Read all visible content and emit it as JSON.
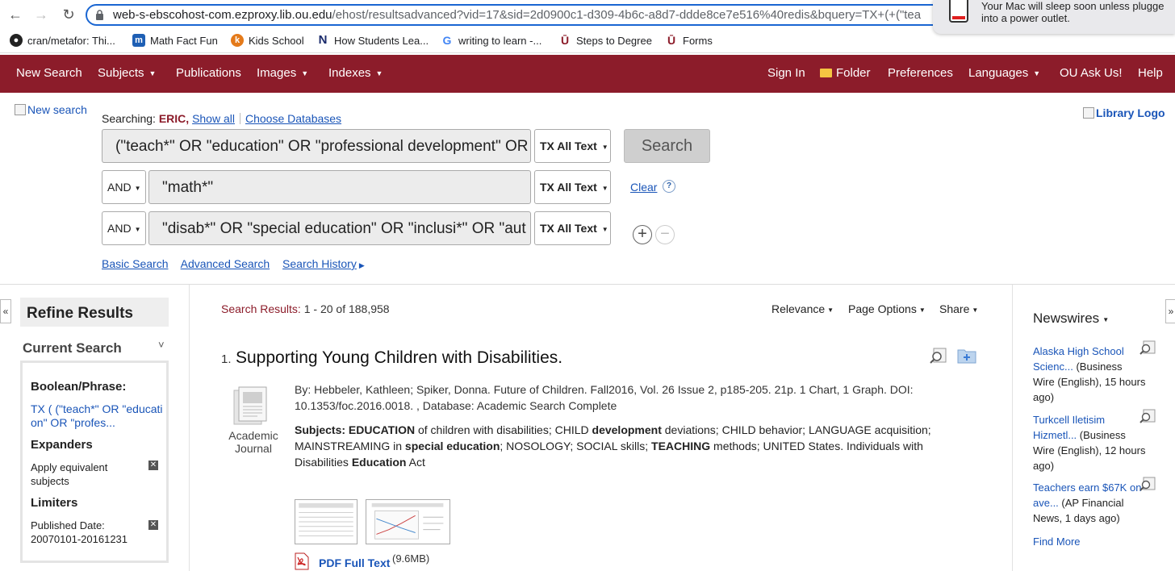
{
  "browser": {
    "url_host": "web-s-ebscohost-com.ezproxy.lib.ou.edu",
    "url_path": "/ehost/resultsadvanced?vid=17&sid=2d0900c1-d309-4b6c-a8d7-ddde8ce7e516%40redis&bquery=TX+(+(\"tea",
    "bookmarks": [
      "cran/metafor: Thi...",
      "Math Fact Fun",
      "Kids School",
      "How Students Lea...",
      "writing to learn -...",
      "Steps to Degree",
      "Forms"
    ],
    "notification": {
      "line1": "Your Mac will sleep soon unless plugge",
      "line2": "into a power outlet."
    }
  },
  "toolbar": {
    "new_search": "New Search",
    "subjects": "Subjects",
    "publications": "Publications",
    "images": "Images",
    "indexes": "Indexes",
    "sign_in": "Sign In",
    "folder": "Folder",
    "preferences": "Preferences",
    "languages": "Languages",
    "ask_us": "OU Ask Us!",
    "help": "Help"
  },
  "search": {
    "new_search_img_alt": "New search",
    "library_logo_alt": "Library Logo",
    "searching_label": "Searching:",
    "database": "ERIC,",
    "show_all": "Show all",
    "choose_databases": "Choose Databases",
    "rows": [
      {
        "bool": "",
        "query": "(\"teach*\" OR \"education\" OR \"professional development\" OR",
        "field": "TX All Text"
      },
      {
        "bool": "AND",
        "query": "\"math*\"",
        "field": "TX All Text"
      },
      {
        "bool": "AND",
        "query": "\"disab*\" OR \"special education\" OR \"inclusi*\" OR \"aut",
        "field": "TX All Text"
      }
    ],
    "search_button": "Search",
    "clear": "Clear",
    "help_icon": "?",
    "links": [
      "Basic Search",
      "Advanced Search",
      "Search History"
    ]
  },
  "refine": {
    "title": "Refine Results",
    "current_search": "Current Search",
    "boolean_label": "Boolean/Phrase:",
    "boolean_value_line1": "TX ( (\"teach*\" OR \"educati",
    "boolean_value_line2": "on\" OR \"profes...",
    "expanders_label": "Expanders",
    "expander_line1": "Apply equivalent",
    "expander_line2": "subjects",
    "limiters_label": "Limiters",
    "limiter_line1": "Published Date:",
    "limiter_line2": "20070101-20161231"
  },
  "results": {
    "count_label": "Search Results:",
    "count_value": "1 - 20 of 188,958",
    "sort": "Relevance",
    "page_options": "Page Options",
    "share": "Share",
    "item": {
      "number": "1.",
      "title": "Supporting Young Children with Disabilities.",
      "doc_type_line1": "Academic",
      "doc_type_line2": "Journal",
      "meta": "By: Hebbeler, Kathleen; Spiker, Donna. Future of Children. Fall2016, Vol. 26 Issue 2, p185-205. 21p. 1 Chart, 1 Graph. DOI: 10.1353/foc.2016.0018. , Database: Academic Search Complete",
      "subjects_label": "Subjects:",
      "subjects_parts": [
        {
          "t": " EDUCATION",
          "b": true
        },
        {
          "t": " of children with disabilities; CHILD ",
          "b": false
        },
        {
          "t": "development",
          "b": true
        },
        {
          "t": " deviations; CHILD behavior; LANGUAGE acquisition; MAINSTREAMING in ",
          "b": false
        },
        {
          "t": "special education",
          "b": true
        },
        {
          "t": "; NOSOLOGY; SOCIAL skills; ",
          "b": false
        },
        {
          "t": "TEACHING",
          "b": true
        },
        {
          "t": " methods; UNITED States. Individuals with Disabilities ",
          "b": false
        },
        {
          "t": "Education",
          "b": true
        },
        {
          "t": " Act",
          "b": false
        }
      ],
      "pdf_label": "PDF Full Text",
      "pdf_size": "(9.6MB)"
    }
  },
  "newswires": {
    "title": "Newswires",
    "items": [
      {
        "link_line1": "Alaska High School",
        "link_line2": "Scienc...",
        "rest_line2": " (Business",
        "rest_line3": "Wire (English), 15 hours",
        "rest_line4": "ago)"
      },
      {
        "link_line1": "Turkcell Iletisim",
        "link_line2": "Hizmetl...",
        "rest_line2": " (Business",
        "rest_line3": "Wire (English), 12 hours",
        "rest_line4": "ago)"
      },
      {
        "link_line1": "Teachers earn $67K on",
        "link_line2": "ave...",
        "rest_line2": " (AP Financial",
        "rest_line3": "News, 1 days ago)",
        "rest_line4": ""
      }
    ],
    "find_more": "Find More"
  },
  "colors": {
    "brand_red": "#8c1c2a",
    "link_blue": "#1a55b8"
  }
}
